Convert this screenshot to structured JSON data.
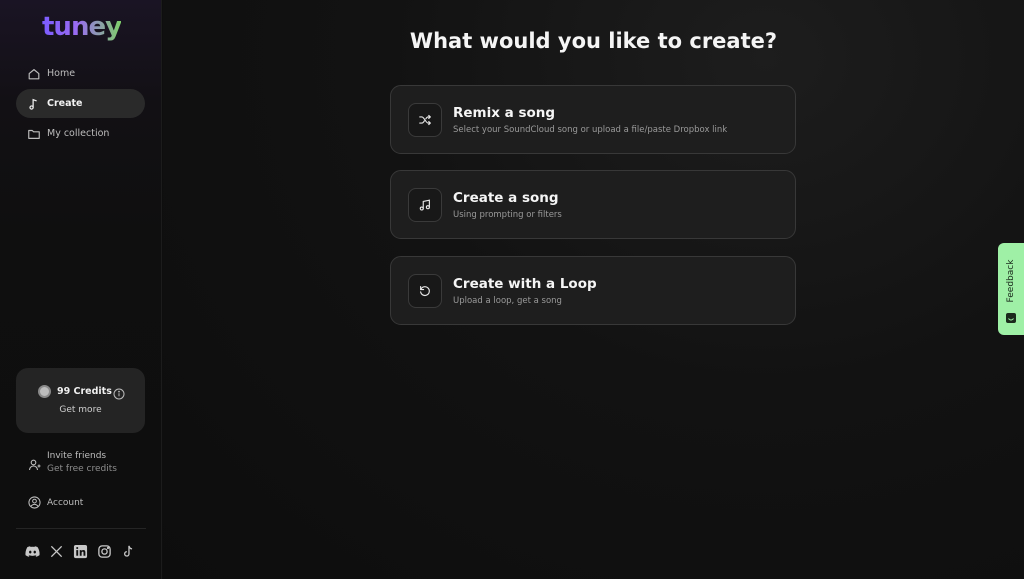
{
  "logo": "tuney",
  "nav": {
    "home": "Home",
    "create": "Create",
    "collection": "My collection"
  },
  "credits": {
    "label": "99 Credits",
    "get_more": "Get more"
  },
  "invite": {
    "title": "Invite friends",
    "subtitle": "Get free credits"
  },
  "account": "Account",
  "socials": [
    "discord-icon",
    "x-icon",
    "linkedin-icon",
    "instagram-icon",
    "tiktok-icon"
  ],
  "main": {
    "heading": "What would you like to create?",
    "cards": [
      {
        "title": "Remix a song",
        "subtitle": "Select your SoundCloud song or upload a file/paste Dropbox link",
        "icon": "shuffle-icon"
      },
      {
        "title": "Create a song",
        "subtitle": "Using prompting or filters",
        "icon": "music-note-icon"
      },
      {
        "title": "Create with a Loop",
        "subtitle": "Upload a loop, get a song",
        "icon": "loop-icon"
      }
    ]
  },
  "feedback": "Feedback",
  "colors": {
    "accent_purple": "#7b5cff",
    "accent_green": "#7fd06a",
    "feedback_bg": "#9ff0a6"
  }
}
